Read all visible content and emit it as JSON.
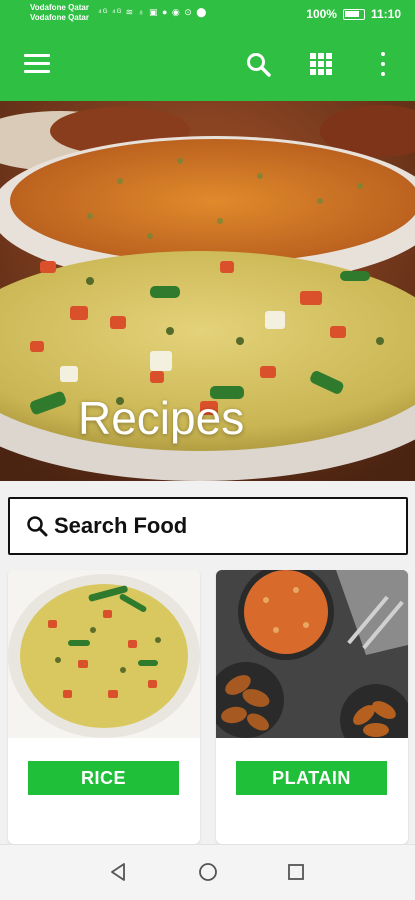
{
  "status_bar": {
    "carrier_1": "Vodafone Qatar",
    "carrier_2": "Vodafone Qatar",
    "icons_text": "⁴ᴳ ⁴ᴳ ≋ ♁ ▣ ● ◉ ⊙ ⬤",
    "battery_percent": "100%",
    "time": "11:10"
  },
  "app_bar": {
    "background_color": "#2fbf43",
    "icons": [
      "menu-icon",
      "search-icon",
      "grid-icon",
      "more-vert-icon"
    ]
  },
  "hero": {
    "title": "Recipes"
  },
  "search": {
    "placeholder": "Search Food"
  },
  "cards": [
    {
      "label": "RICE",
      "image": "vegetable-fried-rice"
    },
    {
      "label": "PLATAIN",
      "image": "jollof-rice-and-plantain"
    }
  ],
  "accent_color": "#1fbf3a",
  "nav_bar": {
    "icons": [
      "back-icon",
      "home-icon",
      "recents-icon"
    ]
  }
}
